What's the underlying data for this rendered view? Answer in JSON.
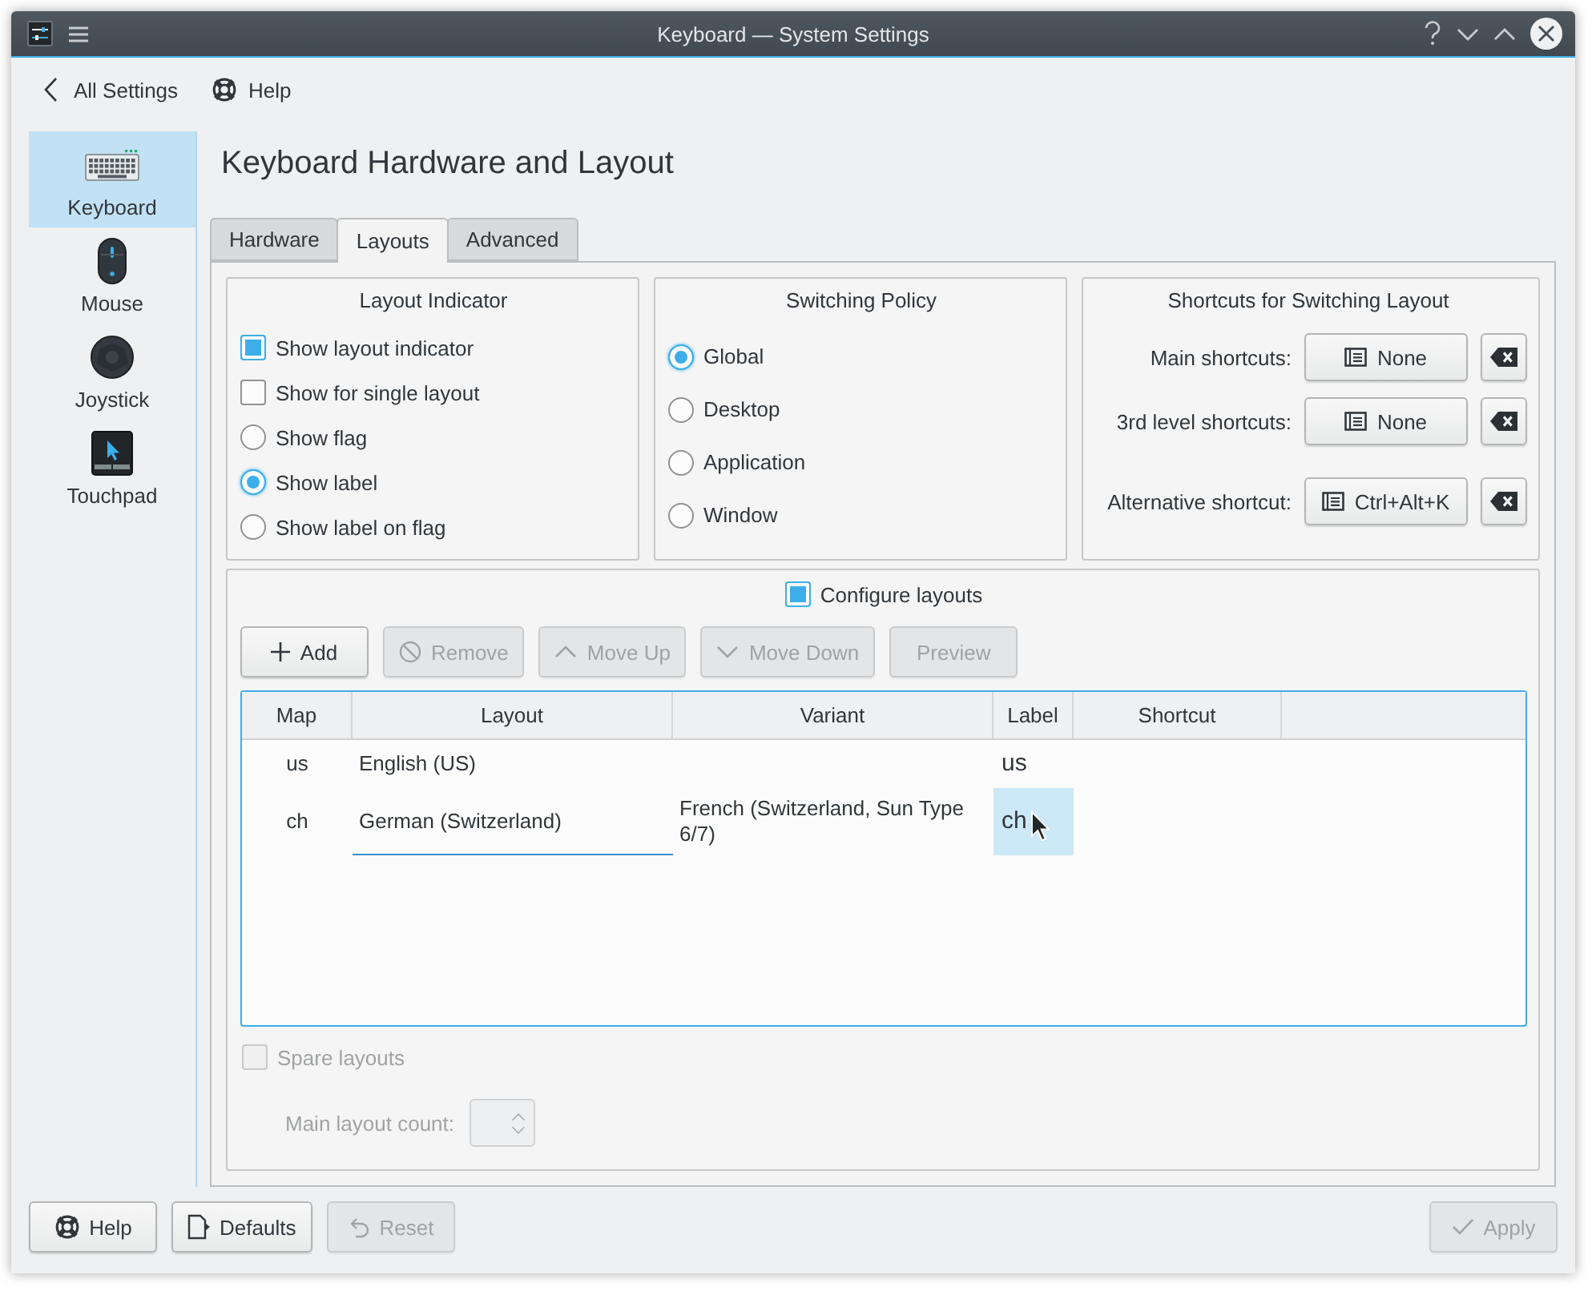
{
  "window": {
    "title": "Keyboard — System Settings"
  },
  "navigation": {
    "back": "All Settings",
    "help": "Help"
  },
  "sidebar": {
    "items": [
      {
        "kind": "keyboard",
        "label": "Keyboard",
        "selected": true
      },
      {
        "kind": "mouse",
        "label": "Mouse",
        "selected": false
      },
      {
        "kind": "joystick",
        "label": "Joystick",
        "selected": false
      },
      {
        "kind": "touchpad",
        "label": "Touchpad",
        "selected": false
      }
    ]
  },
  "page_title": "Keyboard Hardware and Layout",
  "tabs": [
    {
      "label": "Hardware",
      "selected": false
    },
    {
      "label": "Layouts",
      "selected": true
    },
    {
      "label": "Advanced",
      "selected": false
    }
  ],
  "layout_indicator": {
    "title": "Layout Indicator",
    "options": [
      {
        "kind": "checkbox",
        "label": "Show layout indicator",
        "checked": true
      },
      {
        "kind": "checkbox",
        "label": "Show for single layout",
        "checked": false
      },
      {
        "kind": "radio",
        "label": "Show flag",
        "selected": false
      },
      {
        "kind": "radio",
        "label": "Show label",
        "selected": true
      },
      {
        "kind": "radio",
        "label": "Show label on flag",
        "selected": false
      }
    ]
  },
  "switching_policy": {
    "title": "Switching Policy",
    "options": [
      {
        "label": "Global",
        "selected": true
      },
      {
        "label": "Desktop",
        "selected": false
      },
      {
        "label": "Application",
        "selected": false
      },
      {
        "label": "Window",
        "selected": false
      }
    ]
  },
  "shortcuts": {
    "title": "Shortcuts for Switching Layout",
    "rows": [
      {
        "label": "Main shortcuts:",
        "value": "None"
      },
      {
        "label": "3rd level shortcuts:",
        "value": "None"
      },
      {
        "label": "Alternative shortcut:",
        "value": "Ctrl+Alt+K"
      }
    ]
  },
  "configure_layouts": {
    "label": "Configure layouts",
    "checked": true,
    "toolbar": [
      {
        "kind": "add",
        "label": "Add",
        "disabled": false
      },
      {
        "kind": "remove",
        "label": "Remove",
        "disabled": true
      },
      {
        "kind": "up",
        "label": "Move Up",
        "disabled": true
      },
      {
        "kind": "down",
        "label": "Move Down",
        "disabled": true
      },
      {
        "kind": "preview",
        "label": "Preview",
        "disabled": true
      }
    ],
    "table": {
      "columns": [
        "Map",
        "Layout",
        "Variant",
        "Label",
        "Shortcut"
      ],
      "rows": [
        {
          "map": "us",
          "layout": "English (US)",
          "label": "us",
          "selected": false
        },
        {
          "map": "ch",
          "layout": "German (Switzerland)",
          "variant": "French (Switzerland, Sun Type 6/7)",
          "label": "ch",
          "selected": true
        }
      ]
    },
    "spare_layouts": {
      "label": "Spare layouts",
      "checked": false,
      "disabled": true
    },
    "main_layout_count": {
      "label": "Main layout count:",
      "disabled": true
    }
  },
  "footer": {
    "left_buttons": [
      {
        "kind": "help",
        "label": "Help",
        "disabled": false
      },
      {
        "kind": "defaults",
        "label": "Defaults",
        "disabled": false
      },
      {
        "kind": "reset",
        "label": "Reset",
        "disabled": true
      }
    ],
    "right_buttons": [
      {
        "kind": "apply",
        "label": "Apply",
        "disabled": true
      }
    ]
  }
}
